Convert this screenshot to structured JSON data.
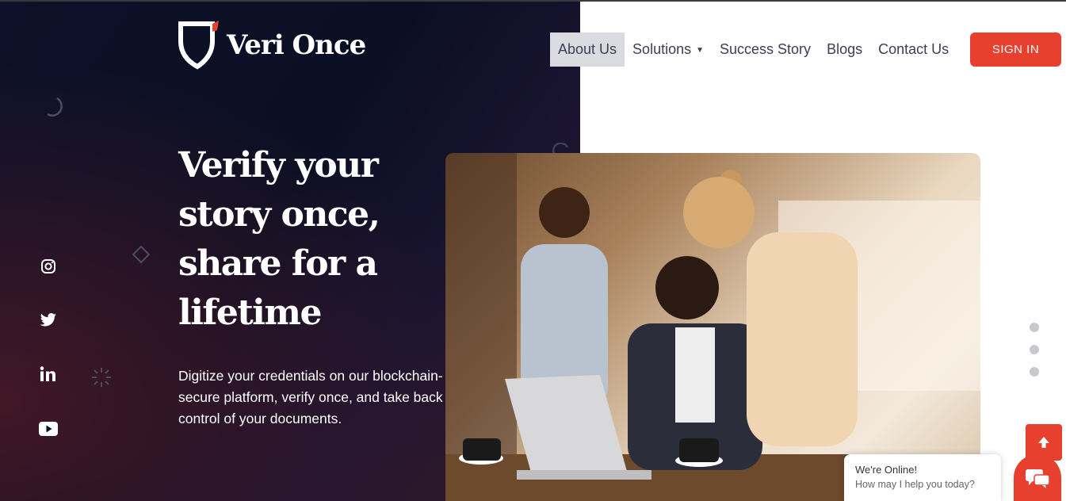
{
  "brand": {
    "name": "Veri Once",
    "accent": "#e8402e"
  },
  "nav": {
    "items": [
      {
        "label": "About Us"
      },
      {
        "label": "Solutions"
      },
      {
        "label": "Success Story"
      },
      {
        "label": "Blogs"
      },
      {
        "label": "Contact Us"
      }
    ],
    "signin_label": "SIGN IN"
  },
  "hero": {
    "headline": "Verify your story once, share for a lifetime",
    "description": "Digitize your credentials on our blockchain-secure platform, verify once, and take back control of your documents."
  },
  "social": [
    "instagram-icon",
    "twitter-icon",
    "linkedin-icon",
    "youtube-icon"
  ],
  "chat": {
    "title": "We're Online!",
    "subtitle": "How may I help you today?"
  }
}
